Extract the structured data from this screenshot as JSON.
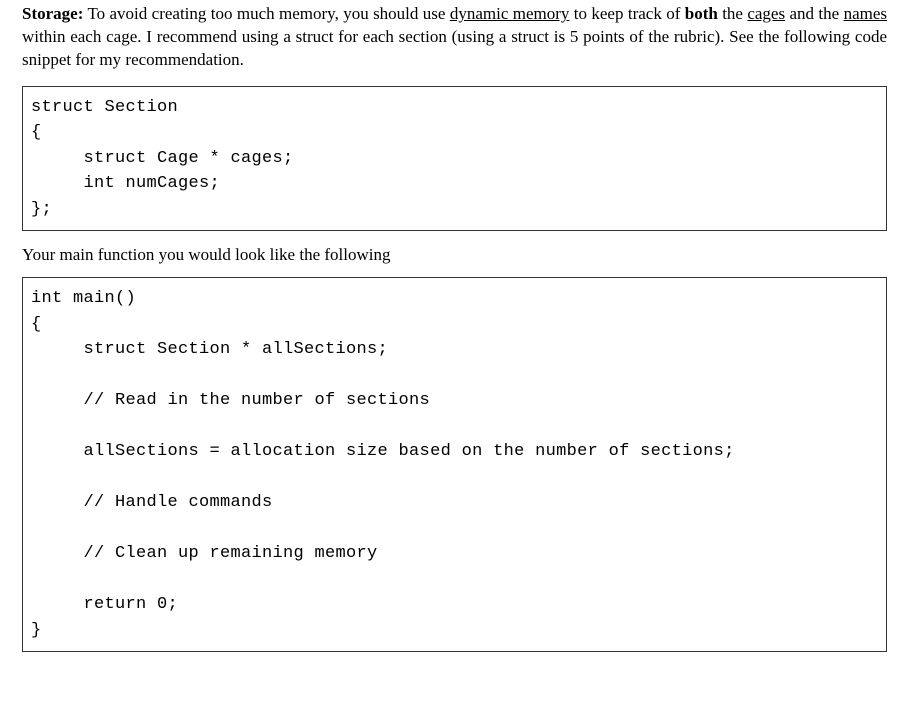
{
  "intro": {
    "label": "Storage:",
    "t1": " To avoid creating too much memory, you should use ",
    "u1": "dynamic memory",
    "t2": " to keep track of ",
    "b1": "both",
    "t3": " the ",
    "u2": "cages",
    "t4": " and the ",
    "u3": "names",
    "t5": " within each cage. I recommend using a struct for each section (using a struct is 5 points of the rubric). See the following code snippet for my recommendation."
  },
  "code1": "struct Section\n{\n     struct Cage * cages;\n     int numCages;\n};",
  "between": "Your main function you would look like the following",
  "code2": "int main()\n{\n     struct Section * allSections;\n\n     // Read in the number of sections\n\n     allSections = allocation size based on the number of sections;\n\n     // Handle commands\n\n     // Clean up remaining memory\n\n     return 0;\n}"
}
